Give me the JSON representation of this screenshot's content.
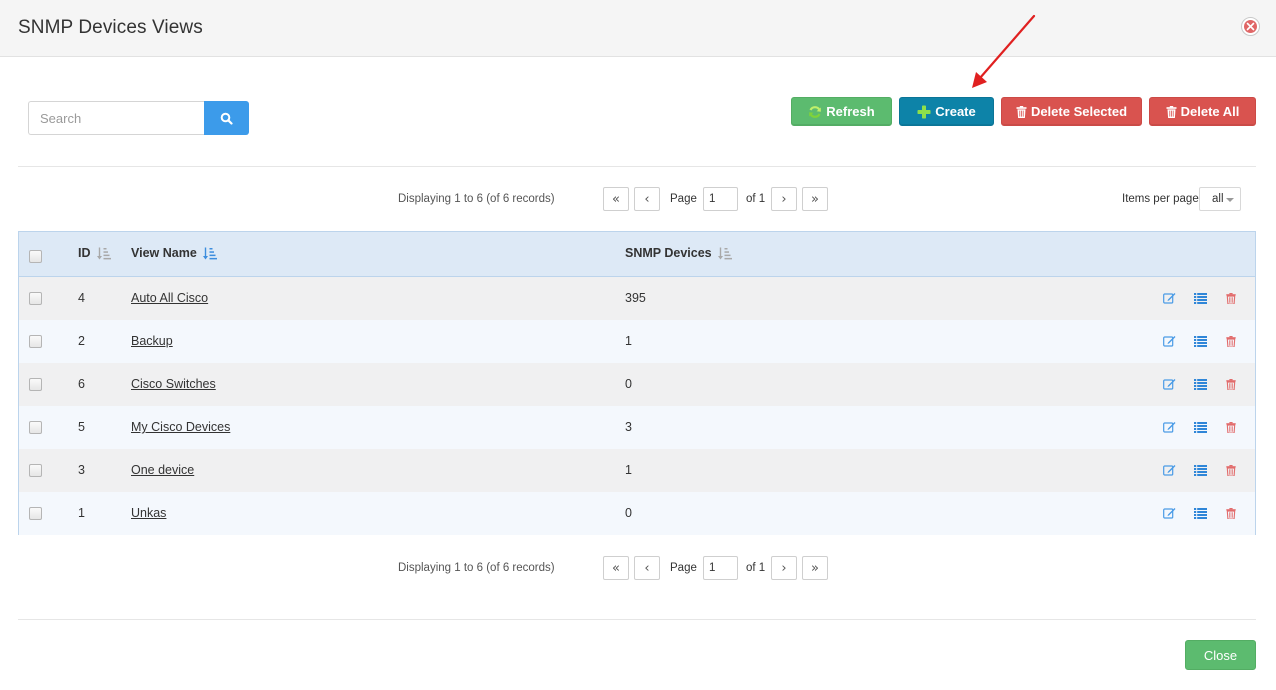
{
  "dialog": {
    "title": "SNMP Devices Views"
  },
  "search": {
    "placeholder": "Search",
    "value": ""
  },
  "toolbar": {
    "refresh_label": "Refresh",
    "create_label": "Create",
    "delete_selected_label": "Delete Selected",
    "delete_all_label": "Delete All"
  },
  "pagination": {
    "info": "Displaying 1 to 6 (of 6 records)",
    "page_label": "Page",
    "current_page": "1",
    "of_label": "of 1",
    "items_per_page_label": "Items per page",
    "items_per_page_value": "all"
  },
  "table": {
    "columns": {
      "id": "ID",
      "view_name": "View Name",
      "snmp_devices": "SNMP Devices"
    },
    "rows": [
      {
        "id": "4",
        "view_name": "Auto All Cisco",
        "snmp_devices": "395"
      },
      {
        "id": "2",
        "view_name": "Backup",
        "snmp_devices": "1"
      },
      {
        "id": "6",
        "view_name": "Cisco Switches",
        "snmp_devices": "0"
      },
      {
        "id": "5",
        "view_name": "My Cisco Devices",
        "snmp_devices": "3"
      },
      {
        "id": "3",
        "view_name": "One device",
        "snmp_devices": "1"
      },
      {
        "id": "1",
        "view_name": "Unkas",
        "snmp_devices": "0"
      }
    ]
  },
  "footer": {
    "close_label": "Close"
  },
  "colors": {
    "refresh": "#5cbb6f",
    "create": "#0d83a8",
    "delete": "#d9534f",
    "search": "#3c9bea",
    "table_header": "#dde9f6",
    "annotation_arrow": "#e02020"
  },
  "icons": {
    "refresh": "refresh-icon",
    "create": "plus-icon",
    "delete": "trash-icon",
    "search": "search-icon",
    "edit": "edit-icon",
    "list": "list-icon",
    "sort": "sort-icon",
    "close": "close-icon"
  }
}
